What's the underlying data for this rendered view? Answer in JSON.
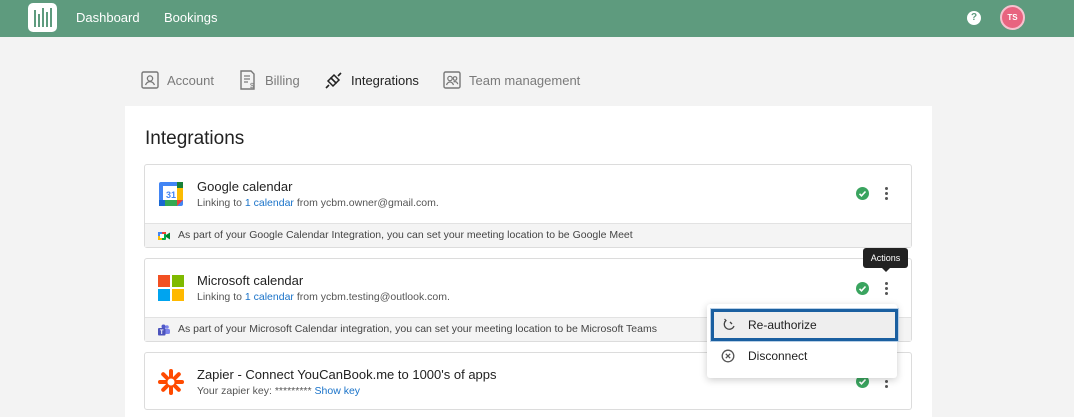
{
  "nav": {
    "links": [
      "Dashboard",
      "Bookings"
    ],
    "avatar_initials": "TS"
  },
  "tabs": [
    {
      "label": "Account",
      "icon": "account-icon"
    },
    {
      "label": "Billing",
      "icon": "billing-icon"
    },
    {
      "label": "Integrations",
      "icon": "integrations-icon",
      "active": true
    },
    {
      "label": "Team management",
      "icon": "team-icon"
    }
  ],
  "page": {
    "title": "Integrations"
  },
  "integrations": [
    {
      "name": "Google calendar",
      "sub_prefix": "Linking to",
      "sub_link": "1 calendar",
      "sub_mid": "from",
      "sub_account": "ycbm.owner@gmail.com",
      "sub_suffix": ".",
      "footer": "As part of your Google Calendar Integration, you can set your meeting location to be Google Meet",
      "icon": "google-calendar-icon",
      "footer_icon": "google-meet-icon"
    },
    {
      "name": "Microsoft calendar",
      "sub_prefix": "Linking to",
      "sub_link": "1 calendar",
      "sub_mid": "from",
      "sub_account": "ycbm.testing@outlook.com",
      "sub_suffix": ".",
      "footer": "As part of your Microsoft Calendar integration, you can set your meeting location to be Microsoft Teams",
      "icon": "microsoft-icon",
      "footer_icon": "teams-icon"
    },
    {
      "name": "Zapier - Connect YouCanBook.me to 1000's of apps",
      "key_label": "Your zapier key:",
      "key_value": "*********",
      "key_link": "Show key",
      "icon": "zapier-icon"
    }
  ],
  "tooltip": "Actions",
  "menu": [
    {
      "label": "Re-authorize",
      "icon": "reauthorize-icon"
    },
    {
      "label": "Disconnect",
      "icon": "disconnect-icon"
    }
  ],
  "colors": {
    "header": "#5e9b7e",
    "link": "#1a73c9",
    "success": "#3aa45f",
    "highlight_border": "#1a5fa0"
  }
}
